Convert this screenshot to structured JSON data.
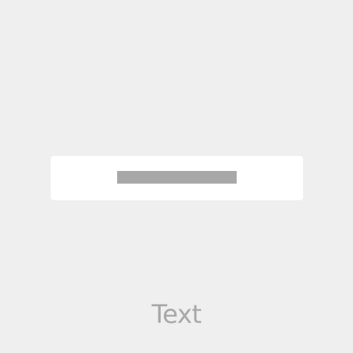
{
  "caption": {
    "label": "Text"
  },
  "colors": {
    "background": "#efefef",
    "card": "#ffffff",
    "placeholder_bar": "#a8a8a8",
    "caption_text": "#a8a8a8"
  }
}
